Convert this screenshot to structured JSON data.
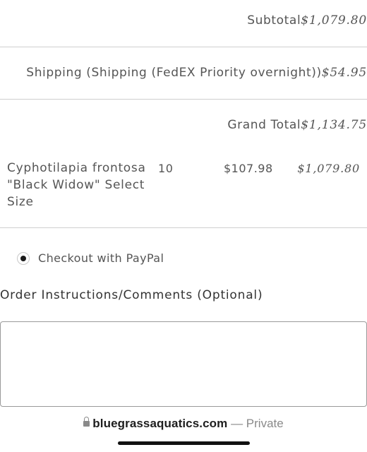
{
  "totals": {
    "subtotal_label": "Subtotal",
    "subtotal_value": "$1,079.80",
    "shipping_label": "Shipping (Shipping (FedEX Priority overnight))",
    "shipping_value": "$54.95",
    "grand_total_label": "Grand Total",
    "grand_total_value": "$1,134.75"
  },
  "items": [
    {
      "name": "Cyphotilapia frontosa \"Black Widow\" Select Size",
      "qty": "10",
      "price": "$107.98",
      "total": "$1,079.80"
    }
  ],
  "payment": {
    "option_label": "Checkout with PayPal",
    "selected": true
  },
  "instructions": {
    "label": "Order Instructions/Comments (Optional)",
    "value": ""
  },
  "browser": {
    "domain": "bluegrassaquatics.com",
    "suffix": " — Private",
    "lock_icon": "lock-icon"
  }
}
